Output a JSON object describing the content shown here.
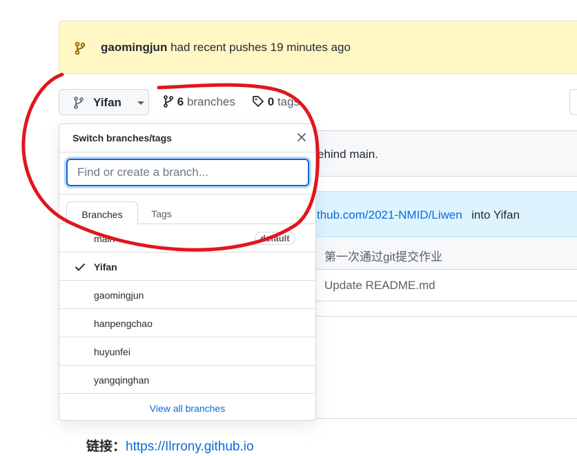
{
  "banner": {
    "user": "gaomingjun",
    "message": "had recent pushes 19 minutes ago"
  },
  "branch_selector": {
    "current": "Yifan"
  },
  "stats": {
    "branches_count": "6",
    "branches_label": "branches",
    "tags_count": "0",
    "tags_label": "tags"
  },
  "repo": {
    "behind_text": "ehind main.",
    "commit_link": "thub.com/2021-NMID/Liwen",
    "commit_tail": "into Yifan",
    "files": [
      {
        "message": "第一次通过git提交作业"
      },
      {
        "message": "Update README.md"
      }
    ]
  },
  "readme": {
    "label": "链接：",
    "link": "https://Ilrrony.github.io"
  },
  "dropdown": {
    "title": "Switch branches/tags",
    "search_placeholder": "Find or create a branch...",
    "tabs": [
      {
        "label": "Branches"
      },
      {
        "label": "Tags"
      }
    ],
    "items": [
      {
        "name": "main",
        "badge": "default",
        "selected": false
      },
      {
        "name": "Yifan",
        "selected": true
      },
      {
        "name": "gaomingjun",
        "selected": false
      },
      {
        "name": "hanpengchao",
        "selected": false
      },
      {
        "name": "huyunfei",
        "selected": false
      },
      {
        "name": "yangqinghan",
        "selected": false
      }
    ],
    "footer_link": "View all branches"
  },
  "colors": {
    "accent": "#0969da",
    "annotation": "#e0161e",
    "banner_bg": "#fff8c5"
  },
  "icons": {
    "banner": "git-branch-icon",
    "branch": "git-branch-icon",
    "tag": "tag-icon",
    "close": "close-icon",
    "check": "check-icon"
  }
}
